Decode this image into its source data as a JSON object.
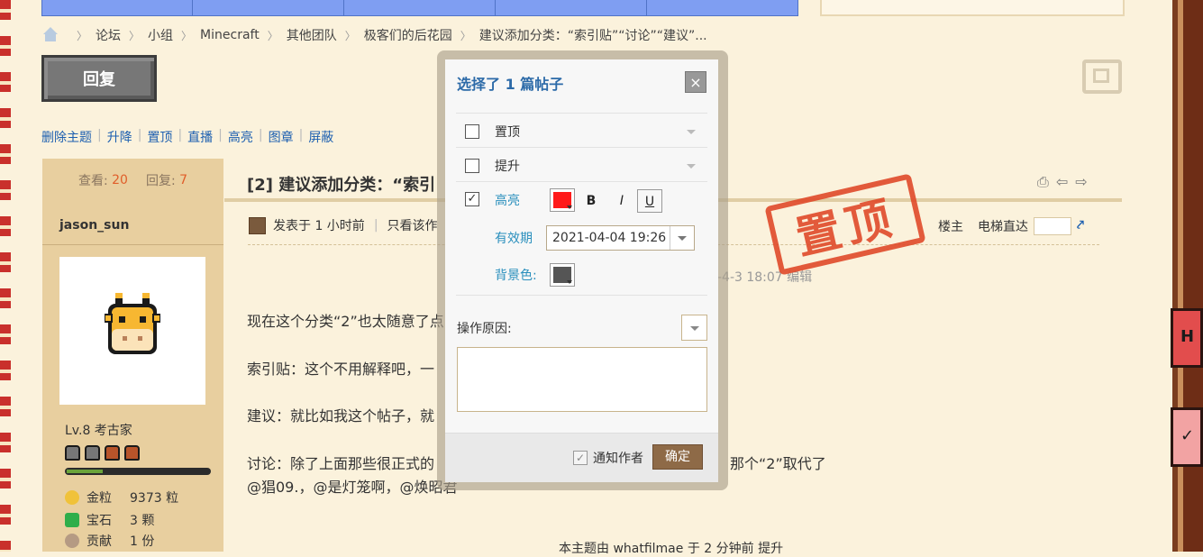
{
  "breadcrumb": [
    "论坛",
    "小组",
    "Minecraft",
    "其他团队",
    "极客们的后花园",
    "建议添加分类：“索引贴”“讨论”“建议”..."
  ],
  "reply_label": "回复",
  "admin_links": [
    "删除主题",
    "升降",
    "置顶",
    "直播",
    "高亮",
    "图章",
    "屏蔽"
  ],
  "stats": {
    "views_label": "查看:",
    "views": "20",
    "replies_label": "回复:",
    "replies": "7"
  },
  "user": {
    "name": "jason_sun",
    "level": "Lv.8 考古家",
    "resources": [
      {
        "label": "金粒",
        "value": "9373 粒",
        "icon": "gold-nugget-icon"
      },
      {
        "label": "宝石",
        "value": "3 颗",
        "icon": "emerald-icon"
      },
      {
        "label": "贡献",
        "value": "1 份",
        "icon": "contribution-icon"
      }
    ]
  },
  "thread": {
    "title": "[2] 建议添加分类：“索引",
    "posted": "发表于 1 小时前",
    "only_author": "只看该作",
    "floor_owner": "楼主",
    "elevator": "电梯直达",
    "edited": "-4-3 18:07 编辑",
    "lines": [
      "现在这个分类“2”也太随意了点",
      "索引贴：这个不用解释吧，一",
      "建议：就比如我这个帖子，就",
      "讨论：除了上面那些很正式的",
      "@猖09.，@是灯笼啊，@焕昭君"
    ],
    "line4_tail": "那个“2”取代了",
    "footnote": "本主题由 whatfilmae 于 2 分钟前 提升",
    "stamp": "置顶"
  },
  "modal": {
    "title": "选择了 1 篇帖子",
    "close": "×",
    "options": [
      {
        "label": "置顶",
        "checked": false
      },
      {
        "label": "提升",
        "checked": false
      },
      {
        "label": "高亮",
        "checked": true
      }
    ],
    "bold": "B",
    "italic": "I",
    "underline": "U",
    "expiry_label": "有效期",
    "expiry_value": "2021-04-04 19:26",
    "bg_label": "背景色:",
    "reason_label": "操作原因:",
    "notify_label": "通知作者",
    "confirm": "确定"
  },
  "colors": {
    "highlight": "#ff1a1a",
    "bg": "#555555",
    "accent": "#2c6aa8"
  }
}
